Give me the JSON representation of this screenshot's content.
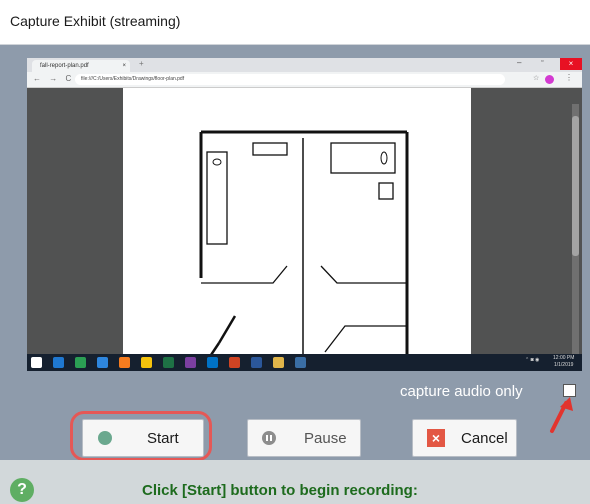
{
  "window": {
    "title": "Capture Exhibit (streaming)"
  },
  "preview": {
    "browser_tab_title": "fall-report-plan.pdf",
    "url": "file:///C:/Users/Exhibits/Drawings/floor-plan.pdf",
    "taskbar_time": "12:00 PM",
    "taskbar_date": "1/1/2019"
  },
  "options": {
    "audio_label": "capture audio only",
    "audio_checked": false
  },
  "buttons": {
    "start": "Start",
    "pause": "Pause",
    "cancel": "Cancel"
  },
  "status": {
    "message": "Click [Start] button to begin recording:",
    "help_glyph": "?"
  },
  "colors": {
    "accent_highlight": "#e55856",
    "status_text": "#1d6b1d",
    "start_dot": "#6aa88e"
  }
}
